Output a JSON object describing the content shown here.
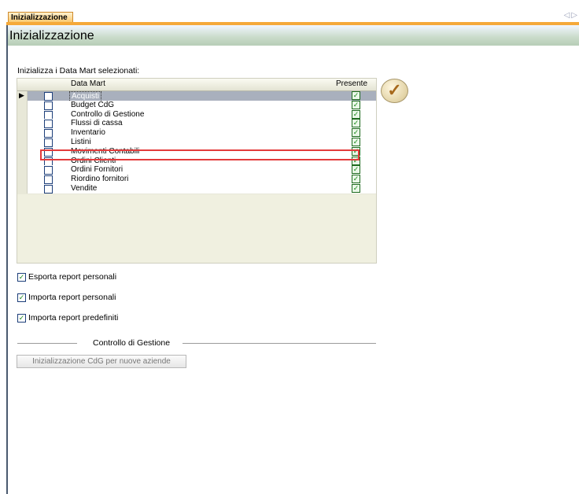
{
  "tab": {
    "label": "Inizializzazione"
  },
  "header": {
    "title": "Inizializzazione"
  },
  "intro": "Inizializza i Data Mart selezionati:",
  "grid": {
    "columns": {
      "datamart": "Data Mart",
      "presente": "Presente"
    },
    "rows": [
      {
        "name": "Acquisti",
        "selected": false,
        "presente": true,
        "active": true
      },
      {
        "name": "Budget CdG",
        "selected": false,
        "presente": true
      },
      {
        "name": "Controllo di Gestione",
        "selected": false,
        "presente": true
      },
      {
        "name": "Flussi di cassa",
        "selected": false,
        "presente": true
      },
      {
        "name": "Inventario",
        "selected": false,
        "presente": true
      },
      {
        "name": "Listini",
        "selected": false,
        "presente": true
      },
      {
        "name": "Movimenti Contabili",
        "selected": false,
        "presente": true
      },
      {
        "name": "Ordini Clienti",
        "selected": false,
        "presente": true
      },
      {
        "name": "Ordini Fornitori",
        "selected": false,
        "presente": true
      },
      {
        "name": "Riordino fornitori",
        "selected": false,
        "presente": true
      },
      {
        "name": "Vendite",
        "selected": false,
        "presente": true
      }
    ]
  },
  "options": [
    {
      "label": "Esporta report personali",
      "checked": true
    },
    {
      "label": "Importa report personali",
      "checked": true
    },
    {
      "label": "Importa report predefiniti",
      "checked": true
    }
  ],
  "cdg": {
    "section_label": "Controllo di Gestione",
    "button_label": "Inizializzazione CdG per nuove aziende"
  },
  "colors": {
    "tab_accent": "#f5a93a",
    "highlight": "#e33b3b",
    "check": "#1b8a1b"
  }
}
